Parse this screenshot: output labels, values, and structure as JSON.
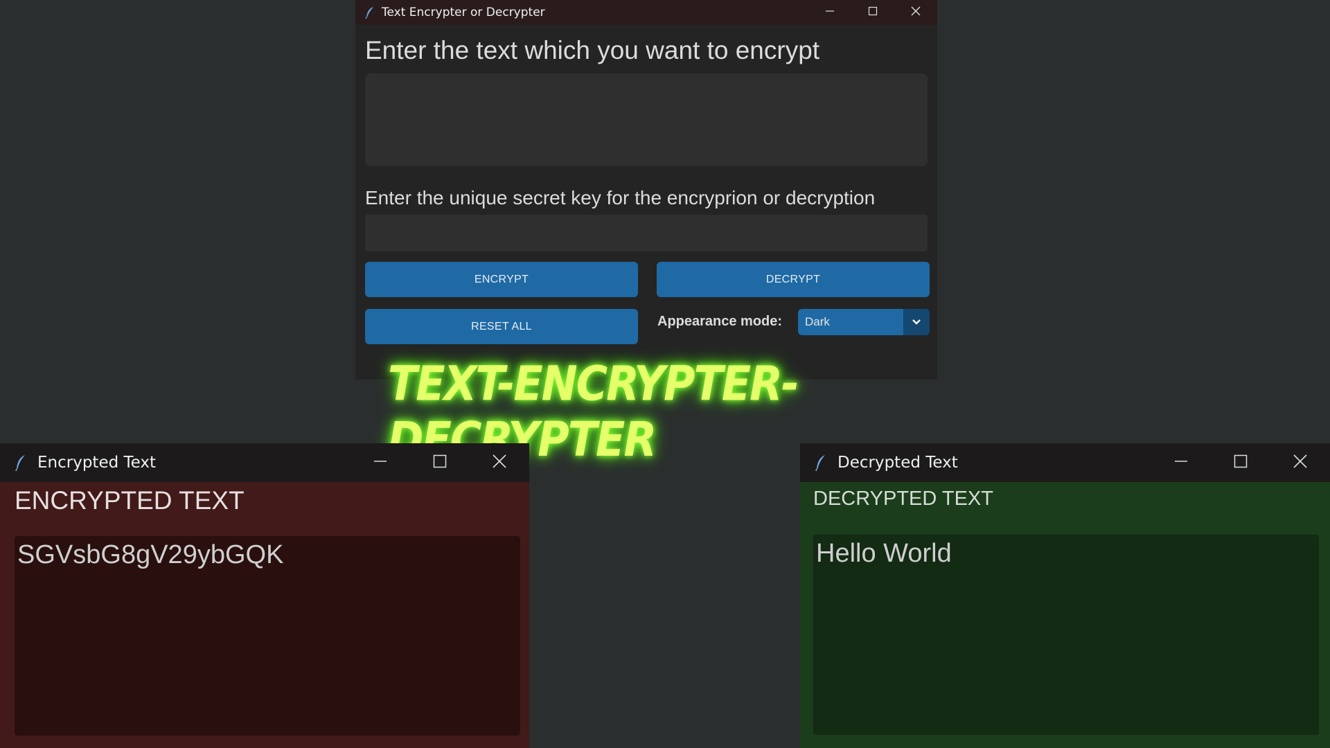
{
  "main_window": {
    "title": "Text Encrypter or Decrypter",
    "text_prompt": "Enter the text which you want to encrypt",
    "text_input_value": "",
    "key_prompt": "Enter the unique secret key for the encryprion or decryption",
    "key_input_value": "",
    "encrypt_label": "ENCRYPT",
    "decrypt_label": "DECRYPT",
    "reset_label": "RESET ALL",
    "appearance_label": "Appearance mode:",
    "appearance_value": "Dark",
    "colors": {
      "accent": "#1f6aa5",
      "background": "#242424"
    }
  },
  "banner": {
    "text": "TEXT-ENCRYPTER-DECRYPTER"
  },
  "encrypted_window": {
    "title": "Encrypted Text",
    "heading": "ENCRYPTED TEXT",
    "content": "SGVsbG8gV29ybGQK",
    "colors": {
      "background": "#421a1a"
    }
  },
  "decrypted_window": {
    "title": "Decrypted Text",
    "heading": "DECRYPTED TEXT",
    "content": "Hello World",
    "colors": {
      "background": "#1b3d1b"
    }
  },
  "icons": {
    "app": "feather-icon",
    "minimize": "minimize-icon",
    "maximize": "maximize-icon",
    "close": "close-icon",
    "dropdown": "chevron-down-icon"
  }
}
